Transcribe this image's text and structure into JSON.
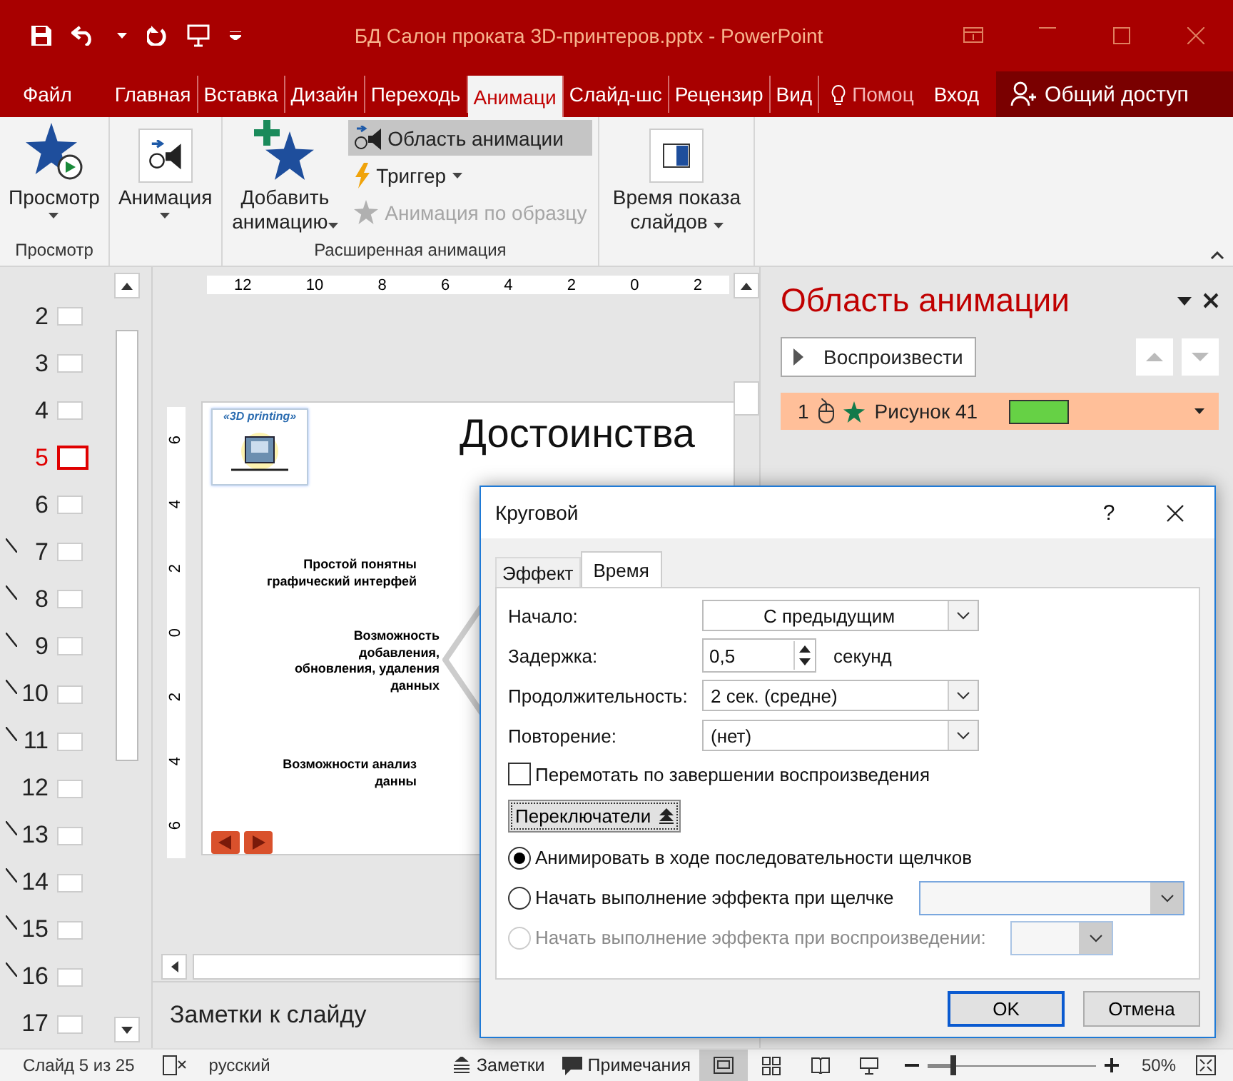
{
  "window": {
    "title": "БД Салон проката 3D-принтеров.pptx - PowerPoint"
  },
  "menu_tabs": [
    {
      "label": "Файл",
      "selected": false
    },
    {
      "label": "Главная",
      "selected": false
    },
    {
      "label": "Вставка",
      "selected": false
    },
    {
      "label": "Дизайн",
      "selected": false
    },
    {
      "label": "Переходь",
      "selected": false
    },
    {
      "label": "Анимаци",
      "selected": true
    },
    {
      "label": "Слайд-шс",
      "selected": false
    },
    {
      "label": "Рецензир",
      "selected": false
    },
    {
      "label": "Вид",
      "selected": false
    }
  ],
  "tell_me": "Помоц",
  "sign_in": "Вход",
  "share": "Общий доступ",
  "ribbon": {
    "preview_button": "Просмотр",
    "preview_group": "Просмотр",
    "animation_button": "Анимация",
    "add_animation_button": "Добавить анимацию",
    "small_buttons": [
      {
        "kind": "pane",
        "label": "Область анимации",
        "selected": true,
        "disabled": false
      },
      {
        "kind": "trigger",
        "label": "Триггер",
        "selected": false,
        "disabled": false
      },
      {
        "kind": "painter",
        "label": "Анимация по образцу",
        "selected": false,
        "disabled": true
      }
    ],
    "advanced_group": "Расширенная анимация",
    "timing_button": "Время показа слайдов"
  },
  "thumbnails": [
    {
      "number": "2",
      "selected": false,
      "animated": false
    },
    {
      "number": "3",
      "selected": false,
      "animated": false
    },
    {
      "number": "4",
      "selected": false,
      "animated": false
    },
    {
      "number": "5",
      "selected": true,
      "animated": false
    },
    {
      "number": "6",
      "selected": false,
      "animated": false
    },
    {
      "number": "7",
      "selected": false,
      "animated": true
    },
    {
      "number": "8",
      "selected": false,
      "animated": true
    },
    {
      "number": "9",
      "selected": false,
      "animated": true
    },
    {
      "number": "10",
      "selected": false,
      "animated": true
    },
    {
      "number": "11",
      "selected": false,
      "animated": true
    },
    {
      "number": "12",
      "selected": false,
      "animated": false
    },
    {
      "number": "13",
      "selected": false,
      "animated": true
    },
    {
      "number": "14",
      "selected": false,
      "animated": true
    },
    {
      "number": "15",
      "selected": false,
      "animated": true
    },
    {
      "number": "16",
      "selected": false,
      "animated": true
    },
    {
      "number": "17",
      "selected": false,
      "animated": false
    }
  ],
  "ruler": {
    "horizontal": [
      "12",
      "10",
      "8",
      "6",
      "4",
      "2",
      "0",
      "2"
    ],
    "vertical": [
      "6",
      "4",
      "2",
      "0",
      "2",
      "4",
      "6"
    ]
  },
  "slide": {
    "logo_text": "«3D printing»",
    "title": "Достоинства",
    "points": [
      {
        "lines": [
          "Простой понятны",
          "графический интерфей"
        ]
      },
      {
        "lines": [
          "Возможность",
          "добавления,",
          "обновления, удаления",
          "данных"
        ]
      },
      {
        "lines": [
          "Возможности анализ",
          "данны"
        ]
      }
    ]
  },
  "notes": "Заметки к слайду",
  "animation_pane": {
    "title": "Область анимации",
    "play_button": "Воспроизвести",
    "items": [
      {
        "number": "1",
        "name": "Рисунок 41",
        "selected": true
      }
    ]
  },
  "dialog": {
    "title": "Круговой",
    "help": "?",
    "tabs": [
      {
        "label": "Эффект",
        "selected": false
      },
      {
        "label": "Время",
        "selected": true
      }
    ],
    "fields": [
      {
        "kind": "select",
        "label": "Начало:",
        "value": "С предыдущим"
      },
      {
        "kind": "spin",
        "label": "Задержка:",
        "value": "0,5",
        "unit": "секунд"
      },
      {
        "kind": "select",
        "label": "Продолжительность:",
        "value": "2 сек. (средне)"
      },
      {
        "kind": "select",
        "label": "Повторение:",
        "value": "(нет)"
      }
    ],
    "rewind": {
      "label": "Перемотать по завершении воспроизведения",
      "checked": false
    },
    "triggers_button": "Переключатели",
    "radios": [
      {
        "label": "Анимировать в ходе последовательности щелчков",
        "selected": true,
        "disabled": false,
        "has_select": false
      },
      {
        "label": "Начать выполнение эффекта при щелчке",
        "selected": false,
        "disabled": false,
        "has_select": true
      },
      {
        "label": "Начать выполнение эффекта при воспроизведении:",
        "selected": false,
        "disabled": true,
        "has_select": true
      }
    ],
    "ok": "OK",
    "cancel": "Отмена"
  },
  "status_bar": {
    "slide_info": "Слайд 5 из 25",
    "language": "русский",
    "notes_button": "Заметки",
    "comments_button": "Примечания",
    "views": [
      {
        "kind": "normal",
        "selected": true
      },
      {
        "kind": "sorter",
        "selected": false
      },
      {
        "kind": "reading",
        "selected": false
      },
      {
        "kind": "show",
        "selected": false
      }
    ],
    "zoom": {
      "level": 0.15
    },
    "zoom_text": "50%"
  }
}
